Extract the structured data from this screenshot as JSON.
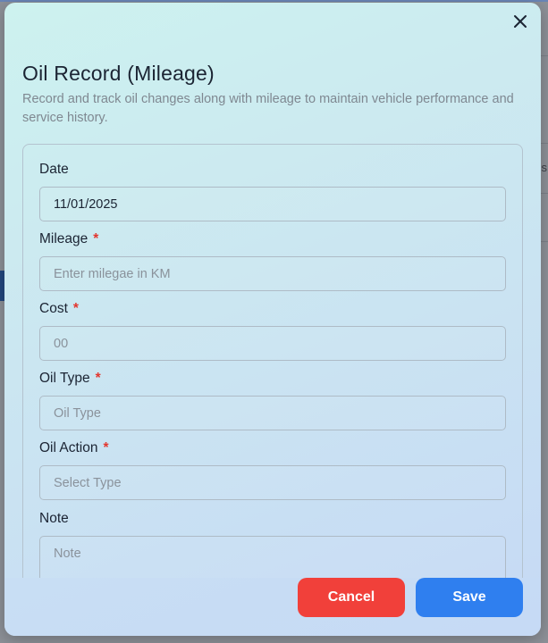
{
  "dialog": {
    "title": "Oil Record (Mileage)",
    "subtitle": "Record and track oil changes along with mileage to maintain vehicle performance and service history.",
    "close_icon": "close-icon"
  },
  "backdrop": {
    "partial_text": "s"
  },
  "form": {
    "date": {
      "label": "Date",
      "required": false,
      "value": "11/01/2025"
    },
    "mileage": {
      "label": "Mileage",
      "required": true,
      "placeholder": "Enter milegae in KM"
    },
    "cost": {
      "label": "Cost",
      "required": true,
      "placeholder": "00"
    },
    "oil_type": {
      "label": "Oil Type",
      "required": true,
      "placeholder": "Oil Type"
    },
    "oil_action": {
      "label": "Oil Action",
      "required": true,
      "placeholder": "Select Type"
    },
    "note": {
      "label": "Note",
      "required": false,
      "placeholder": "Note"
    },
    "required_marker": "*"
  },
  "actions": {
    "cancel_label": "Cancel",
    "save_label": "Save"
  },
  "colors": {
    "cancel": "#f1403a",
    "save": "#2f7fef",
    "required": "#e2372f"
  }
}
